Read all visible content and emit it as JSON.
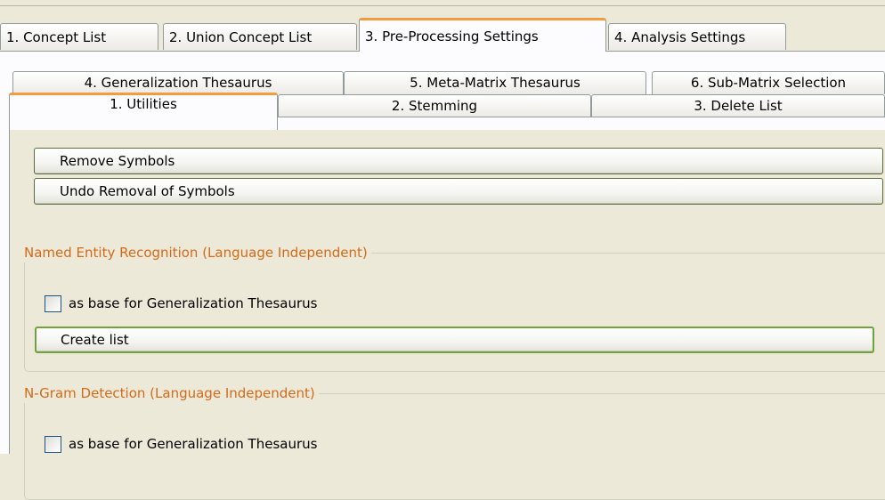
{
  "main_tabs": [
    {
      "label": "1. Concept List"
    },
    {
      "label": "2. Union Concept List"
    },
    {
      "label": "3. Pre-Processing Settings"
    },
    {
      "label": "4. Analysis Settings"
    }
  ],
  "sub_tabs_back": [
    {
      "label": "4. Generalization Thesaurus"
    },
    {
      "label": "5. Meta-Matrix Thesaurus"
    },
    {
      "label": "6. Sub-Matrix Selection"
    }
  ],
  "sub_tabs_front": [
    {
      "label": "1. Utilities"
    },
    {
      "label": "2. Stemming"
    },
    {
      "label": "3. Delete List"
    }
  ],
  "utilities": {
    "remove_symbols": "Remove Symbols",
    "undo_removal": "Undo Removal of Symbols"
  },
  "ner_group": {
    "title": "Named Entity Recognition (Language Independent)",
    "checkbox_label": "as base for Generalization Thesaurus",
    "checked": false,
    "create_list": "Create list"
  },
  "ngram_group": {
    "title": "N-Gram Detection (Language Independent)",
    "checkbox_label": "as base for Generalization Thesaurus",
    "checked": false
  },
  "colors": {
    "accent": "#f29c3b",
    "legend_text": "#d46a1a",
    "button_border": "#5a6b3b"
  }
}
